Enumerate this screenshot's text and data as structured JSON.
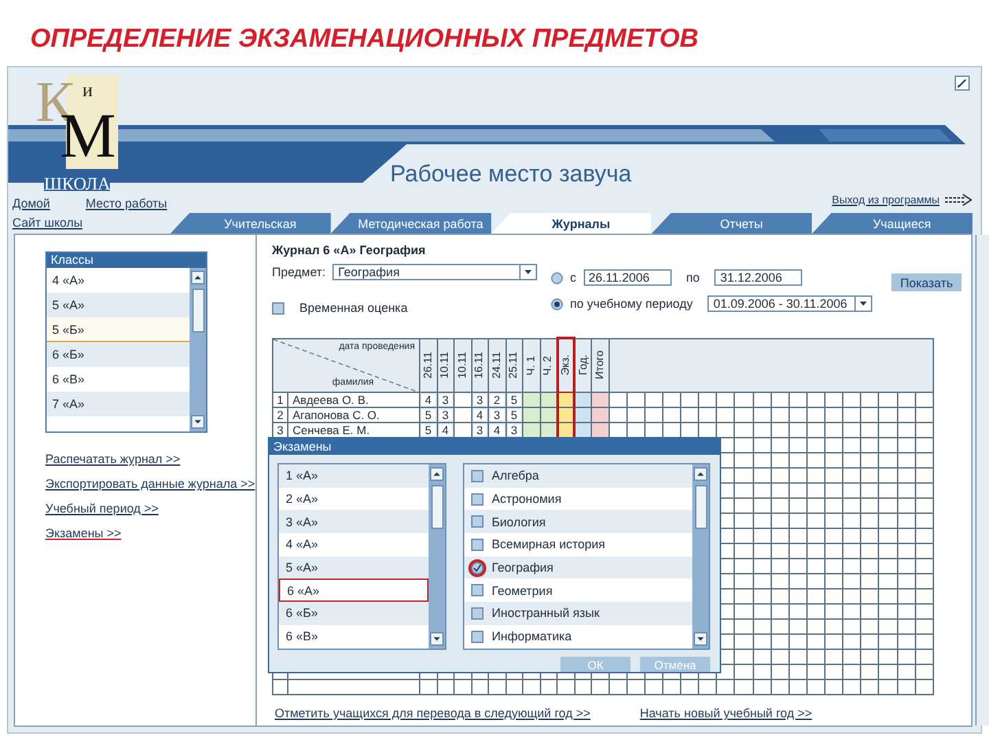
{
  "slide_title": "ОПРЕДЕЛЕНИЕ ЭКЗАМЕНАЦИОННЫХ ПРЕДМЕТОВ",
  "header": {
    "logo": {
      "letters": [
        "К",
        "и",
        "М"
      ],
      "caption": "ШКОЛА"
    },
    "title": "Рабочее место завуча",
    "links": [
      "Домой",
      "Место работы"
    ],
    "site_link": "Сайт школы",
    "exit_link": "Выход из программы"
  },
  "tabs": [
    {
      "label": "Учительская",
      "selected": false
    },
    {
      "label": "Методическая работа",
      "selected": false
    },
    {
      "label": "Журналы",
      "selected": true
    },
    {
      "label": "Отчеты",
      "selected": false
    },
    {
      "label": "Учащиеся",
      "selected": false
    }
  ],
  "classes_list": {
    "title": "Классы",
    "items": [
      {
        "label": "4 «А»",
        "selected": false
      },
      {
        "label": "5 «А»",
        "selected": false
      },
      {
        "label": "5 «Б»",
        "selected": true
      },
      {
        "label": "6 «Б»",
        "selected": false
      },
      {
        "label": "6 «В»",
        "selected": false
      },
      {
        "label": "7 «А»",
        "selected": false
      }
    ]
  },
  "side_links": [
    {
      "label": "Распечатать журнал >>",
      "selected": false
    },
    {
      "label": "Экспортировать данные журнала >>",
      "selected": false
    },
    {
      "label": "Учебный период >>",
      "selected": false
    },
    {
      "label": "Экзамены >>",
      "selected": true
    }
  ],
  "journal": {
    "title": "Журнал 6 «А» География",
    "subject_label": "Предмет:",
    "subject": "География",
    "range": {
      "selected": false,
      "label": "с",
      "from": "26.11.2006",
      "to_label": "по",
      "to": "31.12.2006"
    },
    "period": {
      "selected": true,
      "label": "по учебному периоду",
      "value": "01.09.2006 - 30.11.2006"
    },
    "show_button": "Показать",
    "temp_mark": {
      "label": "Временная оценка",
      "checked": false
    }
  },
  "table": {
    "corner_top": "дата проведения",
    "corner_bottom": "фамилия",
    "columns": [
      {
        "label": "26.11",
        "color": "#ffffff",
        "highlighted": false,
        "has_marks": true
      },
      {
        "label": "10.11",
        "color": "#ffffff",
        "highlighted": false,
        "has_marks": true
      },
      {
        "label": "10.11",
        "color": "#ffffff",
        "highlighted": false,
        "has_marks": false
      },
      {
        "label": "16.11",
        "color": "#ffffff",
        "highlighted": false,
        "has_marks": true
      },
      {
        "label": "24.11",
        "color": "#ffffff",
        "highlighted": false,
        "has_marks": true
      },
      {
        "label": "25.11",
        "color": "#ffffff",
        "highlighted": false,
        "has_marks": true
      },
      {
        "label": "Ч. 1",
        "color": "#d9eecf",
        "highlighted": false,
        "has_marks": false
      },
      {
        "label": "Ч. 2",
        "color": "#d9eecf",
        "highlighted": false,
        "has_marks": false
      },
      {
        "label": "Экз.",
        "color": "#fbe58f",
        "highlighted": true,
        "has_marks": false
      },
      {
        "label": "Год.",
        "color": "#cfe2f1",
        "highlighted": false,
        "has_marks": false
      },
      {
        "label": "Итого",
        "color": "#f3d0cf",
        "highlighted": false,
        "has_marks": false
      }
    ],
    "rows": [
      {
        "number": "1",
        "name": "Авдеева О. В.",
        "marks": [
          "4",
          "3",
          "3",
          "2",
          "5"
        ]
      },
      {
        "number": "2",
        "name": "Агапонова С. О.",
        "marks": [
          "5",
          "3",
          "4",
          "3",
          "5"
        ]
      },
      {
        "number": "3",
        "name": "Сенчева Е. М.",
        "marks": [
          "5",
          "4",
          "3",
          "4",
          "3"
        ]
      }
    ]
  },
  "dialog": {
    "title": "Экзамены",
    "classes": [
      {
        "label": "1 «А»",
        "selected": false
      },
      {
        "label": "2 «А»",
        "selected": false
      },
      {
        "label": "3 «А»",
        "selected": false
      },
      {
        "label": "4 «А»",
        "selected": false
      },
      {
        "label": "5 «А»",
        "selected": false
      },
      {
        "label": "6 «А»",
        "selected": true
      },
      {
        "label": "6 «Б»",
        "selected": false
      },
      {
        "label": "6 «В»",
        "selected": false
      }
    ],
    "subjects": [
      {
        "label": "Алгебра",
        "checked": false
      },
      {
        "label": "Астрономия",
        "checked": false
      },
      {
        "label": "Биология",
        "checked": false
      },
      {
        "label": "Всемирная история",
        "checked": false
      },
      {
        "label": "География",
        "checked": true
      },
      {
        "label": "Геометрия",
        "checked": false
      },
      {
        "label": "Иностранный язык",
        "checked": false
      },
      {
        "label": "Информатика",
        "checked": false
      }
    ],
    "buttons": [
      "ОК",
      "Отмена"
    ]
  },
  "footer_links": [
    "Отметить учащихся для перевода в следующий год >>",
    "Начать новый учебный год >>"
  ]
}
